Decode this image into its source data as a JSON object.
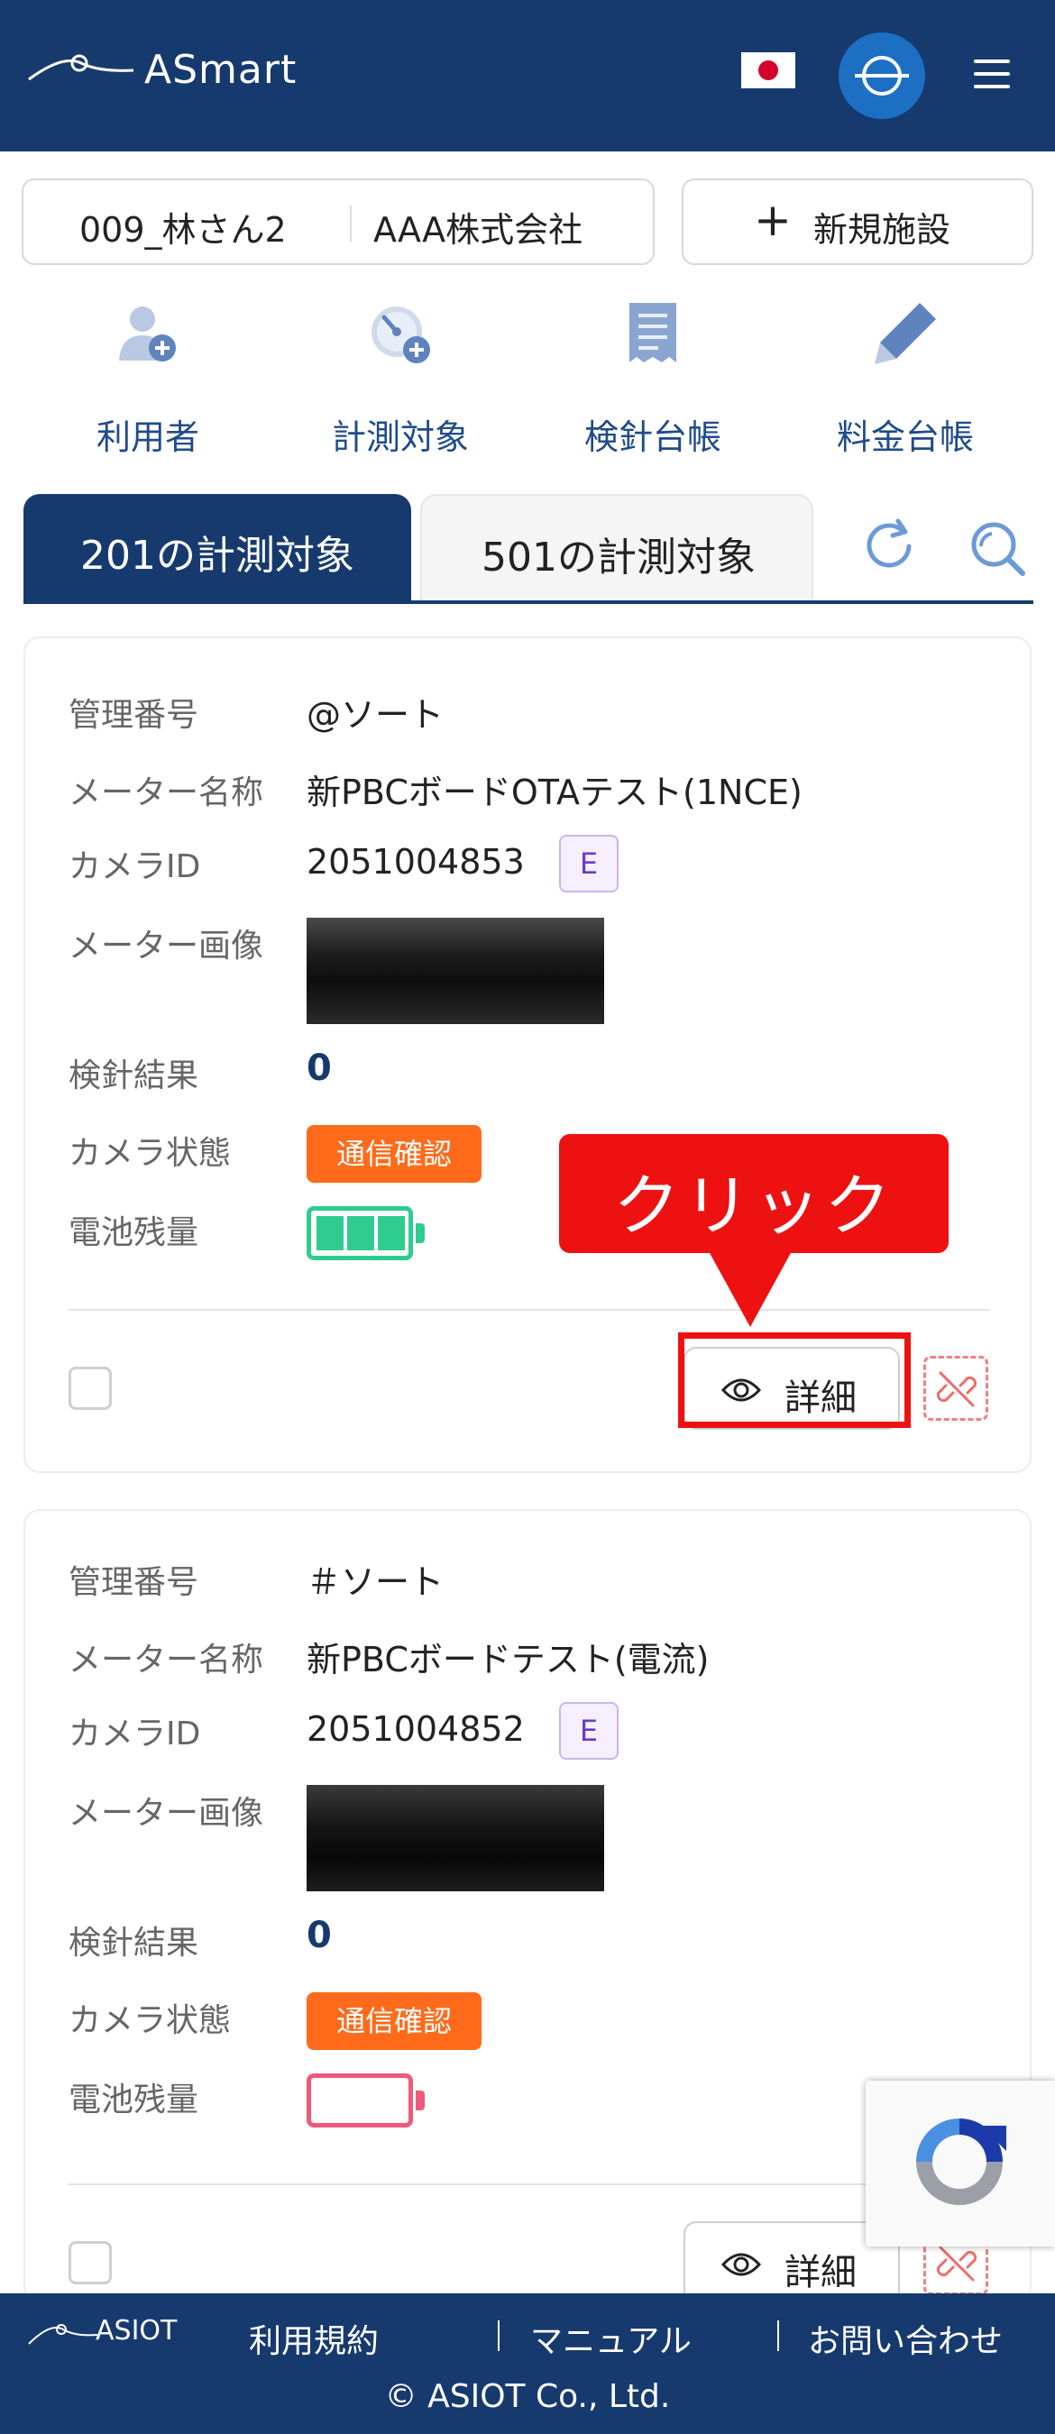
{
  "header": {
    "app_name": "ASmart",
    "flag": "japan-flag-icon",
    "globe": "globe-icon",
    "menu": "menu-icon"
  },
  "facility": {
    "code": "009_林さん2",
    "company": "AAA株式会社",
    "new_button_label": "新規施設"
  },
  "nav": [
    {
      "label": "利用者",
      "icon": "add-user-icon"
    },
    {
      "label": "計測対象",
      "icon": "add-gauge-icon"
    },
    {
      "label": "検針台帳",
      "icon": "receipt-icon"
    },
    {
      "label": "料金台帳",
      "icon": "pencil-icon"
    }
  ],
  "tabs": [
    {
      "label": "201の計測対象",
      "active": true
    },
    {
      "label": "501の計測対象",
      "active": false
    }
  ],
  "labels": {
    "mgmt_no": "管理番号",
    "meter_name": "メーター名称",
    "camera_id": "カメラID",
    "meter_image": "メーター画像",
    "result": "検針結果",
    "camera_status": "カメラ状態",
    "battery": "電池残量",
    "detail": "詳細"
  },
  "cards": [
    {
      "mgmt_no": "@ソート",
      "meter_name": "新PBCボードOTAテスト(1NCE)",
      "camera_id": "2051004853",
      "camera_badge": "E",
      "result": "0",
      "camera_status": "通信確認",
      "battery_level": 1.0
    },
    {
      "mgmt_no": "＃ソート",
      "meter_name": "新PBCボードテスト(電流)",
      "camera_id": "2051004852",
      "camera_badge": "E",
      "result": "0",
      "camera_status": "通信確認",
      "battery_level": 0.0
    }
  ],
  "callout": {
    "text": "クリック",
    "color": "#ee1111"
  },
  "footer": {
    "brand": "ASIOT",
    "links": [
      "利用規約",
      "マニュアル",
      "お問い合わせ"
    ],
    "copyright": "© ASIOT Co., Ltd."
  },
  "colors": {
    "primary": "#173a6e",
    "status_orange": "#ff6b1a",
    "battery_green": "#2ecc8f",
    "battery_empty": "#ef5a7c"
  }
}
